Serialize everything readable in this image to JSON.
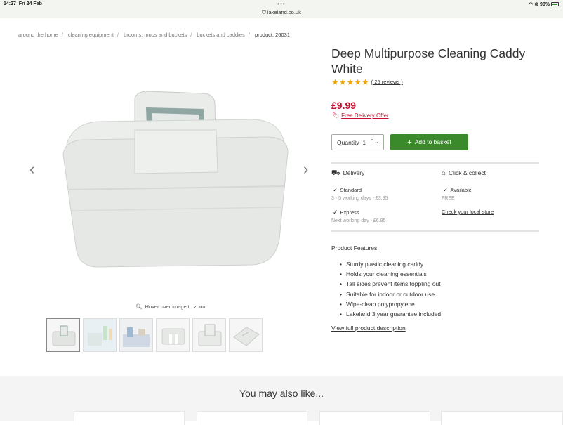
{
  "status": {
    "time": "14:27",
    "date": "Fri 24 Feb",
    "url": "lakeland.co.uk",
    "battery": "90%"
  },
  "breadcrumb": [
    "around the home",
    "cleaning equipment",
    "brooms, mops and buckets",
    "buckets and caddies"
  ],
  "breadcrumb_current": "product: 26031",
  "gallery": {
    "zoom_hint": "Hover over image to zoom",
    "thumb_count": 6
  },
  "product": {
    "title": "Deep Multipurpose Cleaning Caddy White",
    "stars": "★★★★★",
    "reviews": "( 25 reviews )",
    "price": "£9.99",
    "delivery_offer": "Free Delivery Offer",
    "quantity_label": "Quantity",
    "quantity_value": "1",
    "add_to_basket": "Add to basket"
  },
  "delivery": {
    "heading": "Delivery",
    "standard_name": "Standard",
    "standard_sub": "3 - 5 working days - £3.95",
    "express_name": "Express",
    "express_sub": "Next working day - £6.95"
  },
  "collect": {
    "heading": "Click & collect",
    "available": "Available",
    "price": "FREE",
    "store_link": "Check your local store"
  },
  "features": {
    "title": "Product Features",
    "items": [
      "Sturdy plastic cleaning caddy",
      "Holds your cleaning essentials",
      "Tall sides prevent items toppling out",
      "Suitable for indoor or outdoor use",
      "Wipe-clean polypropylene",
      "Lakeland 3 year guarantee included"
    ],
    "full_desc": "View full product description"
  },
  "also": {
    "heading": "You may also like..."
  },
  "colors": {
    "price_red": "#c8102e",
    "button_green": "#3a8a2b",
    "star_gold": "#f0a500"
  }
}
